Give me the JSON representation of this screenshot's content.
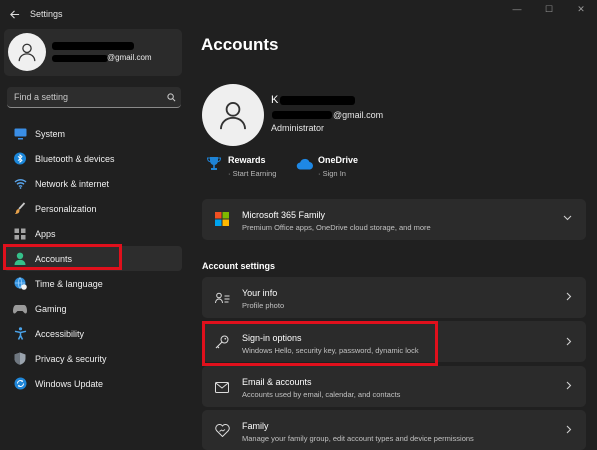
{
  "window": {
    "title": "Settings",
    "controls": [
      "—",
      "☐",
      "✕"
    ]
  },
  "sidebar": {
    "profile": {
      "email_suffix": "@gmail.com"
    },
    "search": {
      "placeholder": "Find a setting"
    },
    "items": [
      {
        "label": "System",
        "icon": "monitor-icon"
      },
      {
        "label": "Bluetooth & devices",
        "icon": "bluetooth-icon"
      },
      {
        "label": "Network & internet",
        "icon": "wifi-icon"
      },
      {
        "label": "Personalization",
        "icon": "brush-icon"
      },
      {
        "label": "Apps",
        "icon": "apps-icon"
      },
      {
        "label": "Accounts",
        "icon": "person-icon",
        "active": true
      },
      {
        "label": "Time & language",
        "icon": "globe-clock-icon"
      },
      {
        "label": "Gaming",
        "icon": "gamepad-icon"
      },
      {
        "label": "Accessibility",
        "icon": "accessibility-icon"
      },
      {
        "label": "Privacy & security",
        "icon": "shield-icon"
      },
      {
        "label": "Windows Update",
        "icon": "update-icon"
      }
    ]
  },
  "main": {
    "title": "Accounts",
    "user": {
      "name_initial": "K",
      "email_suffix": "@gmail.com",
      "role": "Administrator"
    },
    "services": [
      {
        "name": "Rewards",
        "sub": "Start Earning",
        "icon": "trophy-icon"
      },
      {
        "name": "OneDrive",
        "sub": "Sign In",
        "icon": "cloud-icon"
      }
    ],
    "m365": {
      "title": "Microsoft 365 Family",
      "subtitle": "Premium Office apps, OneDrive cloud storage, and more"
    },
    "section_heading": "Account settings",
    "settings": [
      {
        "title": "Your info",
        "subtitle": "Profile photo",
        "icon": "person-card-icon"
      },
      {
        "title": "Sign-in options",
        "subtitle": "Windows Hello, security key, password, dynamic lock",
        "icon": "key-icon"
      },
      {
        "title": "Email & accounts",
        "subtitle": "Accounts used by email, calendar, and contacts",
        "icon": "mail-icon"
      },
      {
        "title": "Family",
        "subtitle": "Manage your family group, edit account types and device permissions",
        "icon": "heart-icon"
      }
    ]
  },
  "colors": {
    "background": "#202020",
    "card": "#2b2b2b",
    "accent": "#60cdff",
    "highlight": "#e0101c"
  }
}
